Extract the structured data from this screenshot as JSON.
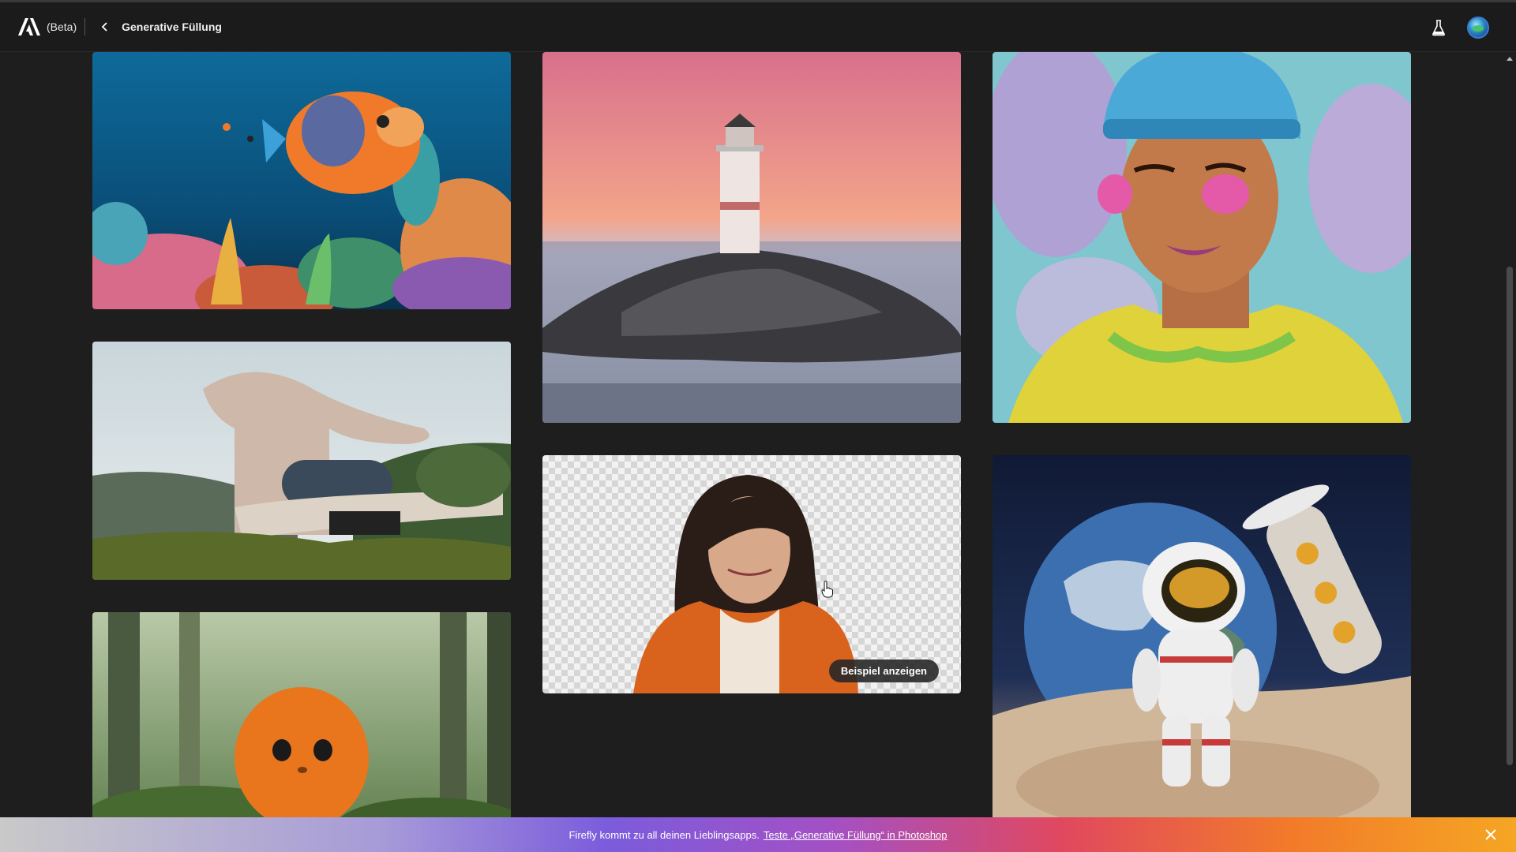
{
  "header": {
    "beta_label": "(Beta)",
    "page_title": "Generative Füllung"
  },
  "gallery": {
    "items": [
      {
        "name": "underwater-fish-reef"
      },
      {
        "name": "futuristic-house"
      },
      {
        "name": "orange-fluffy-creature"
      },
      {
        "name": "lighthouse-sunset"
      },
      {
        "name": "woman-transparent-background"
      },
      {
        "name": "man-colorful-portrait"
      },
      {
        "name": "astronaut-figure-earth"
      }
    ],
    "example_button_label": "Beispiel anzeigen"
  },
  "banner": {
    "text": "Firefly kommt zu all deinen Lieblingsapps.",
    "link_text": "Teste „Generative Füllung“ in Photoshop"
  },
  "colors": {
    "background": "#1e1e1e",
    "topbar": "#1b1b1b",
    "accent_blue": "#3a7bd5"
  }
}
